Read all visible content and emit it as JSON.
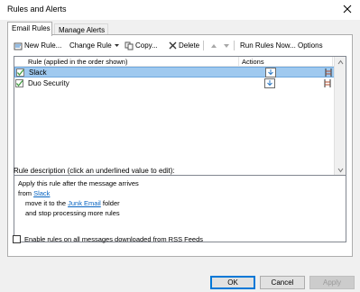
{
  "window": {
    "title": "Rules and Alerts"
  },
  "tabs": [
    {
      "label": "Email Rules",
      "active": true
    },
    {
      "label": "Manage Alerts",
      "active": false
    }
  ],
  "toolbar": {
    "new_rule": "New Rule...",
    "change_rule": "Change Rule",
    "copy": "Copy...",
    "delete": "Delete",
    "run_rules": "Run Rules Now...",
    "options": "Options"
  },
  "table": {
    "headers": [
      "Rule (applied in the order shown)",
      "Actions"
    ],
    "rows": [
      {
        "name": "Slack",
        "checked": true,
        "selected": true
      },
      {
        "name": "Duo Security",
        "checked": true,
        "selected": false
      }
    ]
  },
  "description": {
    "label": "Rule description (click an underlined value to edit):",
    "line1": "Apply this rule after the message arrives",
    "line2_prefix": "from ",
    "line2_link": "Slack",
    "line3_prefix": "move it to the ",
    "line3_link": "Junk Email",
    "line3_suffix": " folder",
    "line4": "and stop processing more rules"
  },
  "rss_option": {
    "label": "Enable rules on all messages downloaded from RSS Feeds",
    "checked": false
  },
  "buttons": {
    "ok": "OK",
    "cancel": "Cancel",
    "apply": "Apply"
  },
  "colors": {
    "selection": "#9fc9ef",
    "link": "#0563c1",
    "check": "#3c9a3c"
  }
}
